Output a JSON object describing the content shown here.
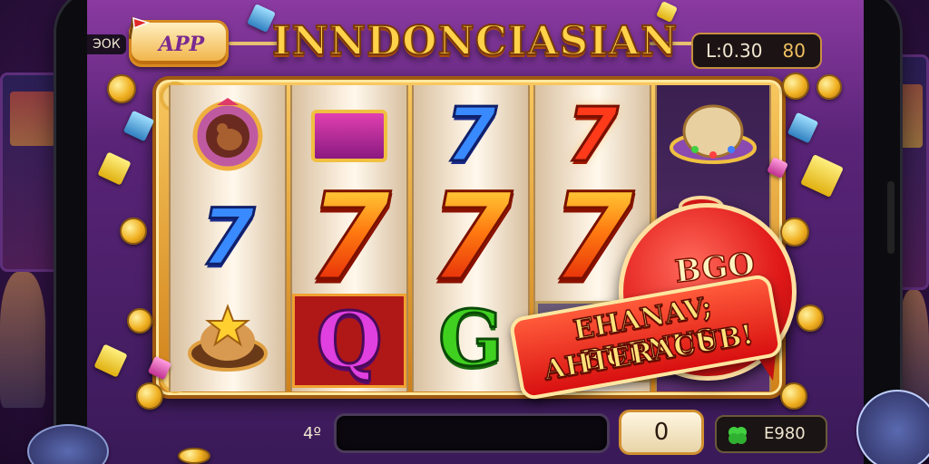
{
  "header": {
    "top_left_label": "ЭОК",
    "app_button_label": "APP",
    "game_title": "INNDONCIASIAN",
    "timer_text": "L:0.30",
    "timer_value": "80"
  },
  "reels": [
    {
      "symbols": [
        "bear-medallion",
        "seven-blue",
        "star-pot"
      ]
    },
    {
      "symbols": [
        "purple-box-tile",
        "seven-red",
        "letter-Q"
      ]
    },
    {
      "symbols": [
        "seven-blue",
        "seven-red",
        "letter-G"
      ]
    },
    {
      "symbols": [
        "seven-red",
        "seven-red",
        "tile"
      ]
    },
    {
      "symbols": [
        "ufo-dome",
        "",
        ""
      ]
    }
  ],
  "symbol_text": {
    "seven": "7",
    "q": "Q",
    "g": "G"
  },
  "bonus": {
    "title": "BGO",
    "line1": "EHANAV; BUENUS",
    "line2": "AHTERACUB!"
  },
  "footer": {
    "bet_label": "4º",
    "message": "",
    "counter_value": "0",
    "credit_text": "E980"
  },
  "colors": {
    "title_gold": "#ffd24a",
    "seven_red": "#ff3a1a",
    "seven_blue": "#3a8aff",
    "bonus_red": "#e01818",
    "screen_purple": "#5a2478"
  }
}
